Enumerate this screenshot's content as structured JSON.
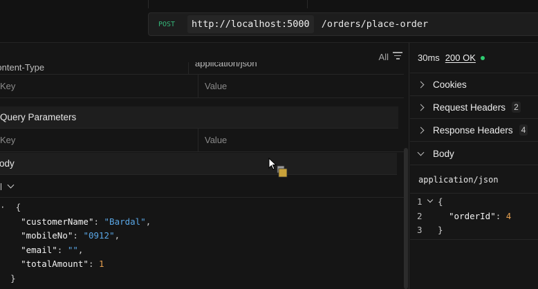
{
  "request": {
    "method": "POST",
    "host": "http://localhost:5000",
    "path": "/orders/place-order"
  },
  "headers_section": {
    "filter_label": "All",
    "header_row": {
      "key": "Content-Type",
      "value": "application/json"
    },
    "empty_row": {
      "key_placeholder": "Key",
      "value_placeholder": "Value"
    }
  },
  "query_section": {
    "title": "Query Parameters",
    "empty_row": {
      "key_placeholder": "Key",
      "value_placeholder": "Value"
    }
  },
  "body_section": {
    "title": "Body",
    "code": {
      "open": "{",
      "fields": [
        {
          "key": "\"customerName\"",
          "value": "\"Bardal\"",
          "type": "str",
          "trail": ","
        },
        {
          "key": "\"mobileNo\"",
          "value": "\"0912\"",
          "type": "str",
          "trail": ","
        },
        {
          "key": "\"email\"",
          "value": "\"\"",
          "type": "str",
          "trail": ","
        },
        {
          "key": "\"totalAmount\"",
          "value": "1",
          "type": "num",
          "trail": ""
        }
      ],
      "close": "}"
    }
  },
  "response": {
    "time": "30ms",
    "status": "200 OK",
    "status_color": "#2ecc71",
    "sections": [
      {
        "label": "Cookies",
        "count": ""
      },
      {
        "label": "Request Headers",
        "count": "2"
      },
      {
        "label": "Response Headers",
        "count": "4"
      },
      {
        "label": "Body",
        "count": ""
      }
    ],
    "content_type": "application/json",
    "code": {
      "line_numbers": [
        "1",
        "2",
        "3"
      ],
      "open": "{",
      "key": "\"orderId\"",
      "value": "4",
      "close": "}"
    }
  },
  "colors": {
    "method": "#35b87a",
    "string": "#5aa7e6",
    "number": "#e6a050"
  }
}
